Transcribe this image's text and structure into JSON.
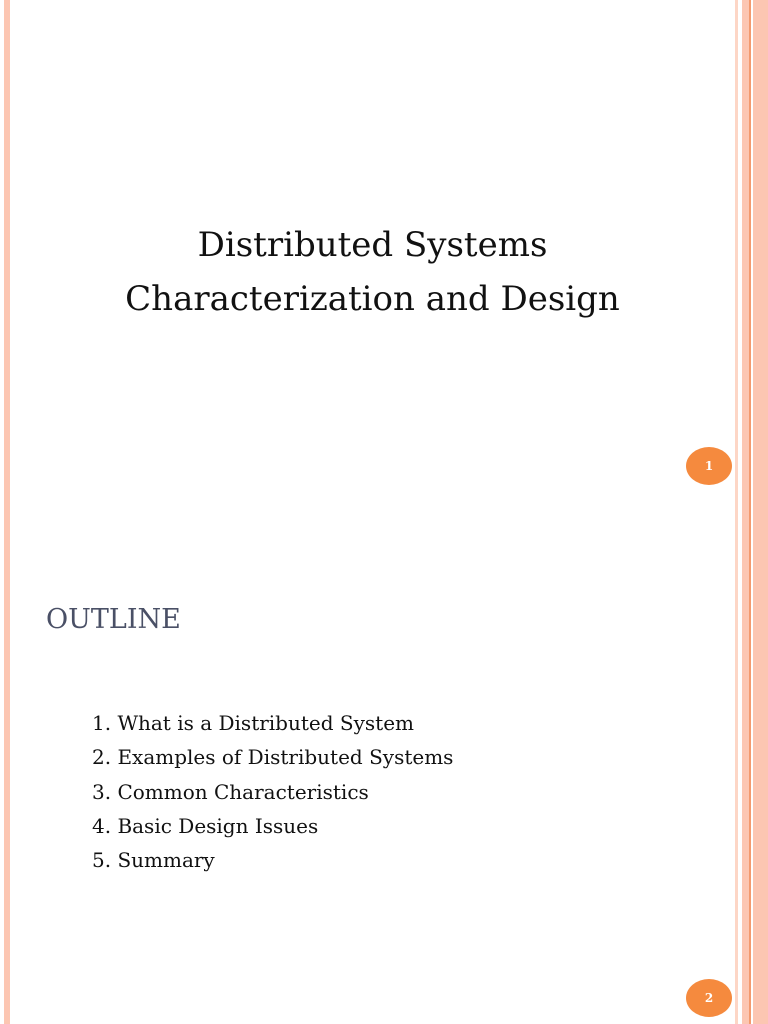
{
  "slides": [
    {
      "title_line1": "Distributed Systems",
      "title_line2": "Characterization and Design",
      "page_number": "1"
    },
    {
      "heading": "OUTLINE",
      "items": [
        "1. What is a Distributed System",
        "2. Examples of Distributed Systems",
        "3. Common Characteristics",
        "4. Basic Design Issues",
        "5. Summary"
      ],
      "page_number": "2"
    }
  ],
  "colors": {
    "accent": "#f58a3e",
    "stripe": "#fcc6b2"
  }
}
